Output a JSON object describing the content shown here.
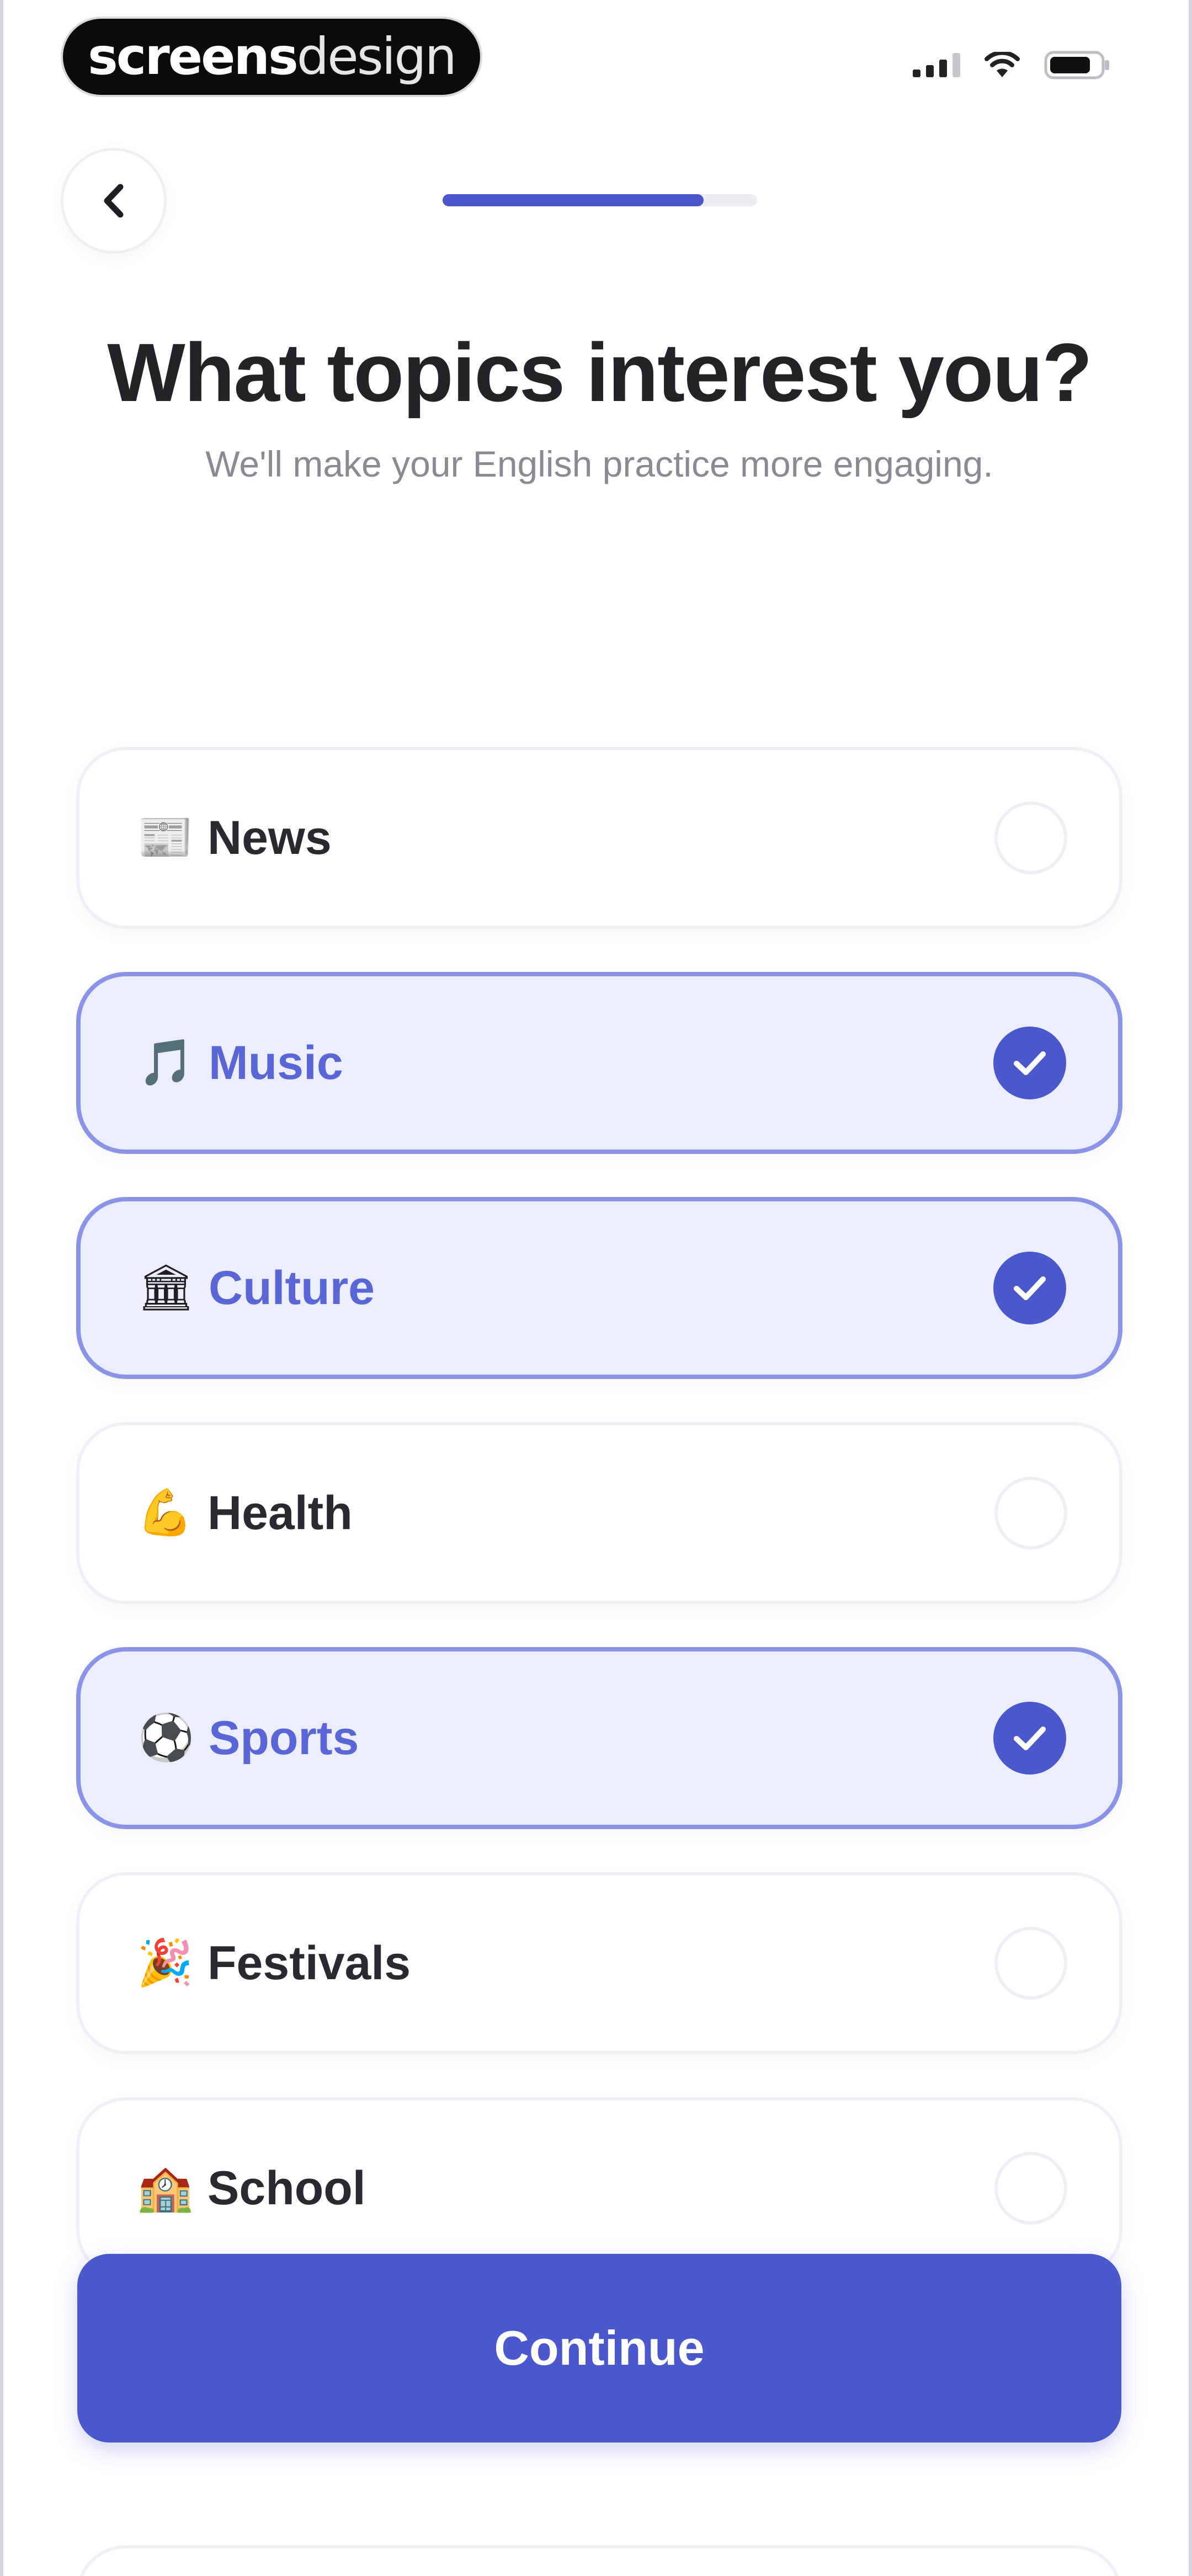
{
  "watermark": {
    "strong": "screens",
    "light": "design"
  },
  "header": {
    "progress_fraction": 0.83
  },
  "page": {
    "title": "What topics interest you?",
    "subtitle": "We'll make your English practice more engaging."
  },
  "topics": [
    {
      "emoji": "📰",
      "label": "News",
      "selected": false
    },
    {
      "emoji": "🎵",
      "label": "Music",
      "selected": true
    },
    {
      "emoji": "🏛",
      "label": "Culture",
      "selected": true
    },
    {
      "emoji": "💪",
      "label": "Health",
      "selected": false
    },
    {
      "emoji": "⚽",
      "label": "Sports",
      "selected": true
    },
    {
      "emoji": "🎉",
      "label": "Festivals",
      "selected": false
    },
    {
      "emoji": "🏫",
      "label": "School",
      "selected": false
    }
  ],
  "footer": {
    "continue_label": "Continue"
  },
  "colors": {
    "accent": "#4a58cc",
    "selected_bg": "#ecedfd",
    "selected_border": "#8a93e6",
    "title": "#232326",
    "subtitle": "#8a8a90"
  }
}
